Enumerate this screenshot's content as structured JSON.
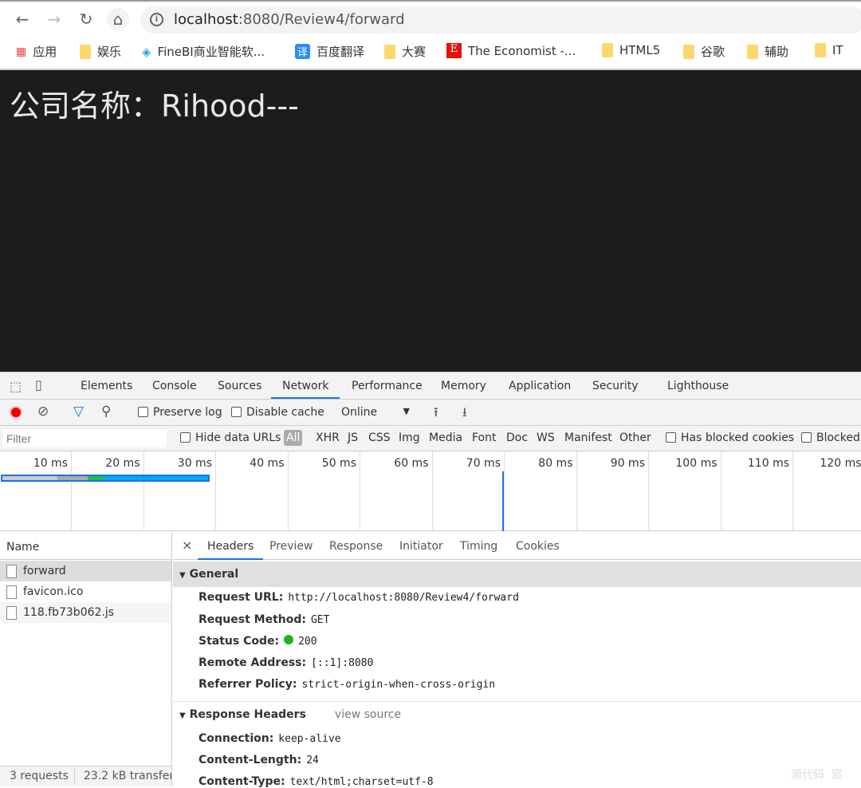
{
  "browser": {
    "url_host": "localhost",
    "url_rest": ":8080/Review4/forward",
    "bookmarks": [
      {
        "label": "应用",
        "icon": "apps-grid-icon"
      },
      {
        "label": "娱乐",
        "icon": "folder-icon"
      },
      {
        "label": "FineBI商业智能软...",
        "icon": "finebi-icon"
      },
      {
        "label": "百度翻译",
        "icon": "baidu-translate-icon"
      },
      {
        "label": "大赛",
        "icon": "folder-icon"
      },
      {
        "label": "The Economist -...",
        "icon": "economist-icon"
      },
      {
        "label": "HTML5",
        "icon": "folder-icon"
      },
      {
        "label": "谷歌",
        "icon": "folder-icon"
      },
      {
        "label": "辅助",
        "icon": "folder-icon"
      },
      {
        "label": "IT",
        "icon": "folder-icon"
      }
    ]
  },
  "page": {
    "heading": "公司名称：Rihood---"
  },
  "devtools": {
    "tabs": [
      "Elements",
      "Console",
      "Sources",
      "Network",
      "Performance",
      "Memory",
      "Application",
      "Security",
      "Lighthouse"
    ],
    "active_tab": "Network",
    "toolbar": {
      "preserve_log": "Preserve log",
      "disable_cache": "Disable cache",
      "throttling": "Online"
    },
    "filter": {
      "placeholder": "Filter",
      "hide_data_urls": "Hide data URLs",
      "types": [
        "All",
        "XHR",
        "JS",
        "CSS",
        "Img",
        "Media",
        "Font",
        "Doc",
        "WS",
        "Manifest",
        "Other"
      ],
      "has_blocked_cookies": "Has blocked cookies",
      "blocked": "Blocked"
    },
    "timeline_ticks": [
      "10 ms",
      "20 ms",
      "30 ms",
      "40 ms",
      "50 ms",
      "60 ms",
      "70 ms",
      "80 ms",
      "90 ms",
      "100 ms",
      "110 ms",
      "120 ms"
    ],
    "name_header": "Name",
    "requests": [
      "forward",
      "favicon.ico",
      "118.fb73b062.js"
    ],
    "footer": {
      "requests": "3 requests",
      "transferred": "23.2 kB transferr"
    },
    "detail_tabs": [
      "Headers",
      "Preview",
      "Response",
      "Initiator",
      "Timing",
      "Cookies"
    ],
    "general": {
      "title": "General",
      "rows": [
        {
          "k": "Request URL:",
          "v": "http://localhost:8080/Review4/forward"
        },
        {
          "k": "Request Method:",
          "v": "GET"
        },
        {
          "k": "Status Code:",
          "v": "200"
        },
        {
          "k": "Remote Address:",
          "v": "[::1]:8080"
        },
        {
          "k": "Referrer Policy:",
          "v": "strict-origin-when-cross-origin"
        }
      ]
    },
    "response_headers": {
      "title": "Response Headers",
      "view_source": "view source",
      "rows": [
        {
          "k": "Connection:",
          "v": "keep-alive"
        },
        {
          "k": "Content-Length:",
          "v": "24"
        },
        {
          "k": "Content-Type:",
          "v": "text/html;charset=utf-8"
        }
      ]
    }
  },
  "watermark": "源代码  宸"
}
